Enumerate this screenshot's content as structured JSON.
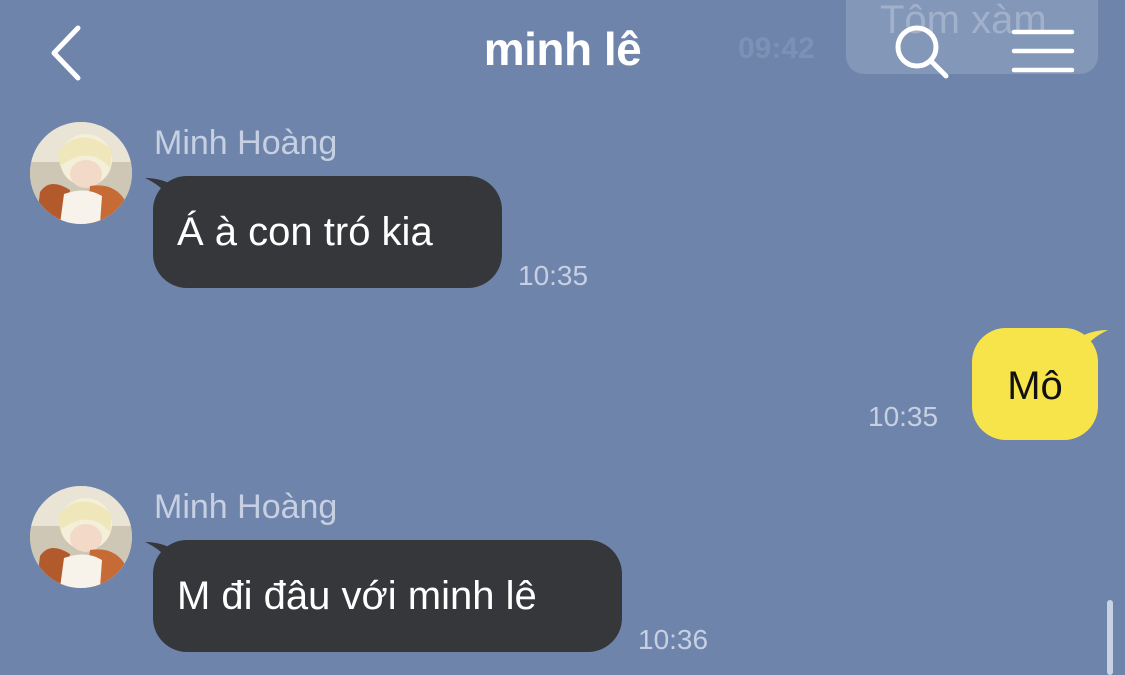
{
  "header": {
    "title": "minh lê",
    "back_icon": "chevron-left-icon",
    "search_icon": "search-icon",
    "menu_icon": "menu-icon",
    "ghost_time": "09:42",
    "ghost_text": "Tôm xàm"
  },
  "messages": [
    {
      "direction": "incoming",
      "sender": "Minh Hoàng",
      "text": "Á à con tró kia",
      "time": "10:35"
    },
    {
      "direction": "outgoing",
      "text": "Mô",
      "time": "10:35"
    },
    {
      "direction": "incoming",
      "sender": "Minh Hoàng",
      "text": "M đi đâu với minh lê",
      "time": "10:36"
    }
  ],
  "colors": {
    "background": "#6e84aa",
    "incoming_bubble": "#36373b",
    "outgoing_bubble": "#f7e44a"
  }
}
